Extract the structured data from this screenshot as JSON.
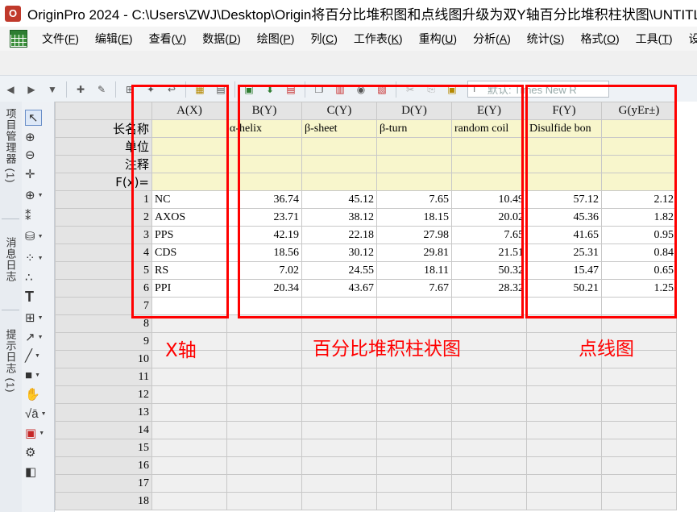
{
  "window": {
    "title": "OriginPro 2024 - C:\\Users\\ZWJ\\Desktop\\Origin将百分比堆积图和点线图升级为双Y轴百分比堆积柱状图\\UNTITLED -"
  },
  "menubar": {
    "items": [
      {
        "label": "文件(",
        "key": "F",
        "end": ")"
      },
      {
        "label": "编辑(",
        "key": "E",
        "end": ")"
      },
      {
        "label": "查看(",
        "key": "V",
        "end": ")"
      },
      {
        "label": "数据(",
        "key": "D",
        "end": ")"
      },
      {
        "label": "绘图(",
        "key": "P",
        "end": ")"
      },
      {
        "label": "列(",
        "key": "C",
        "end": ")"
      },
      {
        "label": "工作表(",
        "key": "K",
        "end": ")"
      },
      {
        "label": "重构(",
        "key": "U",
        "end": ")"
      },
      {
        "label": "分析(",
        "key": "A",
        "end": ")"
      },
      {
        "label": "统计(",
        "key": "S",
        "end": ")"
      },
      {
        "label": "格式(",
        "key": "O",
        "end": ")"
      },
      {
        "label": "工具(",
        "key": "T",
        "end": ")"
      },
      {
        "label": "设置(",
        "key": "",
        "end": ""
      }
    ]
  },
  "toolbar": {
    "font_value": "默认: Times New R"
  },
  "side_tabs": {
    "project_manager": "项目管理器 (1)",
    "message_log": "消息日志",
    "hint_log": "提示日志 (1)"
  },
  "worksheet": {
    "columns": [
      "A(X)",
      "B(Y)",
      "C(Y)",
      "D(Y)",
      "E(Y)",
      "F(Y)",
      "G(yEr±)"
    ],
    "meta_labels": [
      "长名称",
      "单位",
      "注释",
      "F(x)="
    ],
    "long_names": [
      "",
      "α-helix",
      "β-sheet",
      "β-turn",
      "random coil",
      "Disulfide bon",
      ""
    ],
    "rows": [
      {
        "n": "1",
        "a": "NC",
        "b": "36.74",
        "c": "45.12",
        "d": "7.65",
        "e": "10.49",
        "f": "57.12",
        "g": "2.12"
      },
      {
        "n": "2",
        "a": "AXOS",
        "b": "23.71",
        "c": "38.12",
        "d": "18.15",
        "e": "20.02",
        "f": "45.36",
        "g": "1.82"
      },
      {
        "n": "3",
        "a": "PPS",
        "b": "42.19",
        "c": "22.18",
        "d": "27.98",
        "e": "7.65",
        "f": "41.65",
        "g": "0.95"
      },
      {
        "n": "4",
        "a": "CDS",
        "b": "18.56",
        "c": "30.12",
        "d": "29.81",
        "e": "21.51",
        "f": "25.31",
        "g": "0.84"
      },
      {
        "n": "5",
        "a": "RS",
        "b": "7.02",
        "c": "24.55",
        "d": "18.11",
        "e": "50.32",
        "f": "15.47",
        "g": "0.65"
      },
      {
        "n": "6",
        "a": "PPI",
        "b": "20.34",
        "c": "43.67",
        "d": "7.67",
        "e": "28.32",
        "f": "50.21",
        "g": "1.25"
      }
    ],
    "empty_rows": [
      "7",
      "8",
      "9",
      "10",
      "11",
      "12",
      "13",
      "14",
      "15",
      "16",
      "17",
      "18"
    ]
  },
  "annotations": {
    "x_axis": "X轴",
    "stacked_bar": "百分比堆积柱状图",
    "dot_line": "点线图"
  },
  "colors": {
    "annotation_red": "#ff0000",
    "meta_row_bg": "#f8f6cc"
  }
}
